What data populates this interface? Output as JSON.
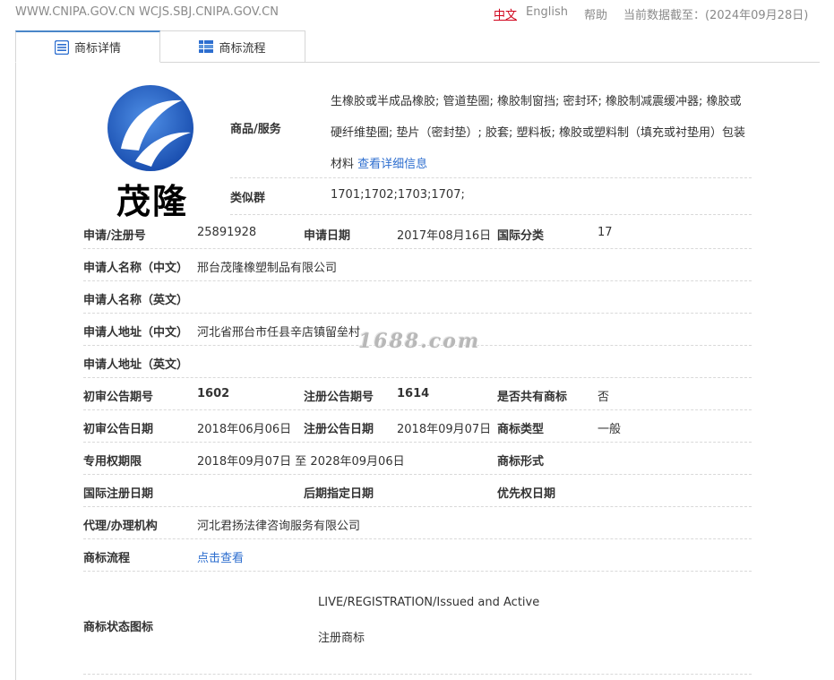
{
  "topbar": {
    "url": "WWW.CNIPA.GOV.CN WCJS.SBJ.CNIPA.GOV.CN",
    "lang_zh": "中文",
    "lang_en": "English",
    "help": "帮助",
    "as_of": "当前数据截至：(2024年09月28日)"
  },
  "tabs": [
    {
      "label": "商标详情",
      "active": true
    },
    {
      "label": "商标流程",
      "active": false
    }
  ],
  "logo": {
    "text": "茂隆",
    "color": "#1f5fc4"
  },
  "goods": {
    "label": "商品/服务",
    "text": "生橡胶或半成品橡胶; 管道垫圈; 橡胶制窗挡; 密封环; 橡胶制减震缓冲器; 橡胶或硬纤维垫圈; 垫片（密封垫）; 胶套; 塑料板; 橡胶或塑料制（填充或衬垫用）包装材料",
    "more": "查看详细信息"
  },
  "similar_group": {
    "label": "类似群",
    "value": "1701;1702;1703;1707;"
  },
  "rows": {
    "reg_no": {
      "label": "申请/注册号",
      "value": "25891928"
    },
    "app_date": {
      "label": "申请日期",
      "value": "2017年08月16日"
    },
    "intl_class": {
      "label": "国际分类",
      "value": "17"
    },
    "applicant_cn": {
      "label": "申请人名称（中文）",
      "value": "邢台茂隆橡塑制品有限公司"
    },
    "applicant_en": {
      "label": "申请人名称（英文）",
      "value": ""
    },
    "address_cn": {
      "label": "申请人地址（中文）",
      "value": "河北省邢台市任县辛店镇留垒村"
    },
    "address_en": {
      "label": "申请人地址（英文）",
      "value": ""
    },
    "prelim_no": {
      "label": "初审公告期号",
      "value": "1602"
    },
    "reg_notice_no": {
      "label": "注册公告期号",
      "value": "1614"
    },
    "shared": {
      "label": "是否共有商标",
      "value": "否"
    },
    "prelim_date": {
      "label": "初审公告日期",
      "value": "2018年06月06日"
    },
    "reg_notice_date": {
      "label": "注册公告日期",
      "value": "2018年09月07日"
    },
    "mark_type": {
      "label": "商标类型",
      "value": "一般"
    },
    "exclusive_period": {
      "label": "专用权期限",
      "value": "2018年09月07日 至 2028年09月06日"
    },
    "mark_form": {
      "label": "商标形式",
      "value": ""
    },
    "intl_reg_date": {
      "label": "国际注册日期",
      "value": ""
    },
    "later_designation": {
      "label": "后期指定日期",
      "value": ""
    },
    "priority_date": {
      "label": "优先权日期",
      "value": ""
    },
    "agency": {
      "label": "代理/办理机构",
      "value": "河北君扬法律咨询服务有限公司"
    },
    "process": {
      "label": "商标流程",
      "value": "点击查看"
    },
    "status": {
      "label": "商标状态图标",
      "value_en": "LIVE/REGISTRATION/Issued and Active",
      "value_cn": "注册商标"
    }
  },
  "watermark": "1688.com"
}
